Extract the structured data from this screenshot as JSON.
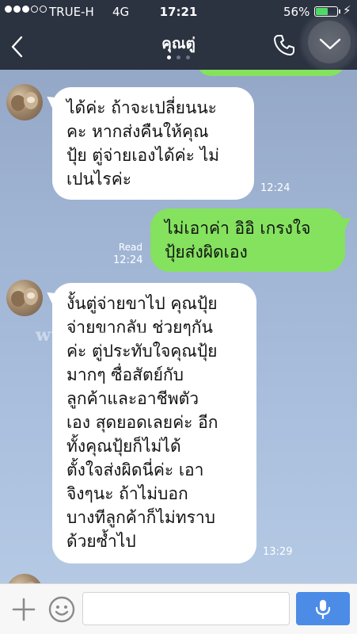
{
  "status_bar": {
    "carrier": "TRUE-H",
    "network": "4G",
    "time": "17:21",
    "battery_percent": "56%",
    "battery_level": 0.56,
    "signal_bars": 3,
    "signal_total": 5
  },
  "header": {
    "title": "คุณตู่",
    "page_count": 3,
    "active_page": 1
  },
  "messages": [
    {
      "side": "left",
      "lines": [
        "ได้ค่ะ ถ้าจะเปลี่ยนนะ",
        "คะ หากส่งคืนให้คุณ",
        "ปุ้ย ตู่จ่ายเองได้ค่ะ ไม่",
        "เปนไรค่ะ"
      ],
      "time": "12:24"
    },
    {
      "side": "right",
      "lines": [
        "ไม่เอาค่า อิอิ เกรงใจ",
        "ปุ้ยส่งผิดเอง"
      ],
      "read_label": "Read",
      "time": "12:24"
    },
    {
      "side": "left",
      "lines": [
        "งั้นตู่จ่ายขาไป คุณปุ้ย",
        "จ่ายขากลับ ช่วยๆกัน",
        "ค่ะ ตู่ประทับใจคุณปุ้ย",
        "มากๆ ซื่อสัตย์กับ",
        "ลูกค้าและอาชีพตัว",
        "เอง สุดยอดเลยค่ะ อีก",
        "ทั้งคุณปุ้ยก็ไม่ได้",
        "ตั้งใจส่งผิดนี่ค่ะ เอา",
        "จิงๆนะ ถ้าไม่บอก",
        "บางทีลูกค้าก็ไม่ทราบ",
        "ด้วยซ้ำไป"
      ],
      "time": "13:29"
    }
  ],
  "watermark": "www.                                    g.com",
  "input": {
    "value": "",
    "placeholder": ""
  },
  "colors": {
    "header_bg": "#2b3240",
    "outgoing_bubble": "#84e25e",
    "incoming_bubble": "#ffffff",
    "mic_button": "#4c8ce6",
    "battery_fill": "#4cd964"
  }
}
